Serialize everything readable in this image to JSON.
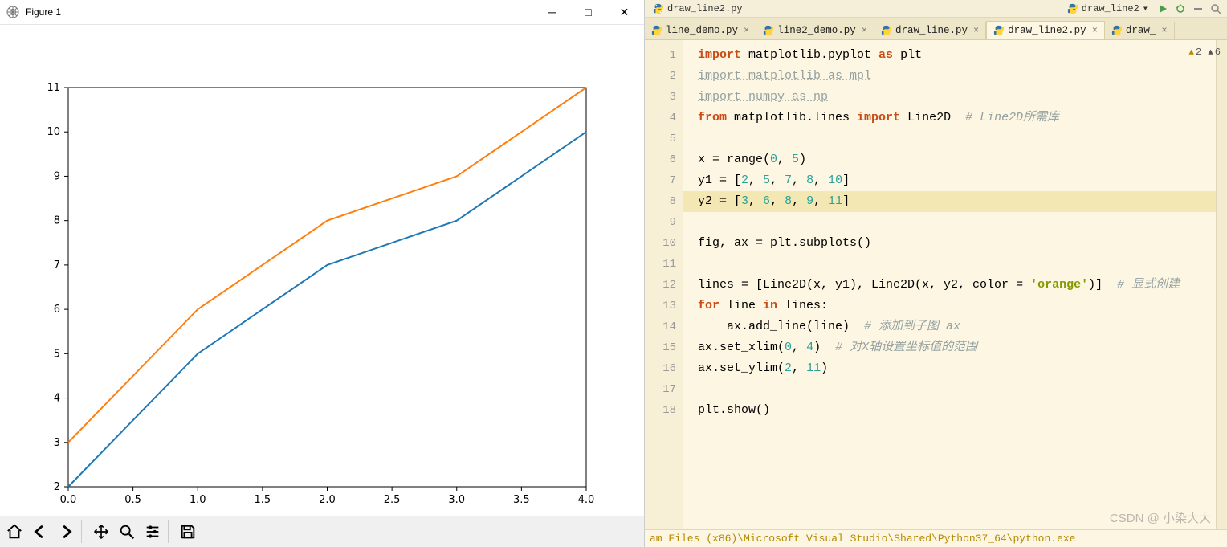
{
  "chart_data": {
    "type": "line",
    "x": [
      0,
      1,
      2,
      3,
      4
    ],
    "series": [
      {
        "name": "y1",
        "values": [
          2,
          5,
          7,
          8,
          10
        ],
        "color": "#1f77b4"
      },
      {
        "name": "y2",
        "values": [
          3,
          6,
          8,
          9,
          11
        ],
        "color": "#ff7f0e"
      }
    ],
    "xlim": [
      0,
      4
    ],
    "ylim": [
      2,
      11
    ],
    "xticks": [
      0.0,
      0.5,
      1.0,
      1.5,
      2.0,
      2.5,
      3.0,
      3.5,
      4.0
    ],
    "yticks": [
      2,
      3,
      4,
      5,
      6,
      7,
      8,
      9,
      10,
      11
    ],
    "xtick_labels": [
      "0.0",
      "0.5",
      "1.0",
      "1.5",
      "2.0",
      "2.5",
      "3.0",
      "3.5",
      "4.0"
    ],
    "ytick_labels": [
      "2",
      "3",
      "4",
      "5",
      "6",
      "7",
      "8",
      "9",
      "10",
      "11"
    ]
  },
  "window": {
    "title": "Figure 1"
  },
  "toolbar": {
    "home": "Home",
    "back": "Back",
    "forward": "Forward",
    "pan": "Pan",
    "zoom": "Zoom",
    "configure": "Configure subplots",
    "save": "Save"
  },
  "ide": {
    "top_tab": "draw_line2.py",
    "combo": "draw_line2",
    "tabs": [
      {
        "label": "line_demo.py",
        "active": false
      },
      {
        "label": "line2_demo.py",
        "active": false
      },
      {
        "label": "draw_line.py",
        "active": false
      },
      {
        "label": "draw_line2.py",
        "active": true
      },
      {
        "label": "draw_",
        "active": false
      }
    ],
    "warnings": "2",
    "criticals": "6",
    "lines": {
      "l1": "import matplotlib.pyplot as plt",
      "l2": "import matplotlib as mpl",
      "l3": "import numpy as np",
      "l4a": "from matplotlib.lines import Line2D ",
      "l4c": "# Line2D所需库",
      "l6": "x = range(0, 5)",
      "l7": "y1 = [2, 5, 7, 8, 10]",
      "l8": "y2 = [3, 6, 8, 9, 11]",
      "l10": "fig, ax = plt.subplots()",
      "l12a": "lines = [Line2D(x, y1), Line2D(x, y2, color = 'orange')] ",
      "l12c": "# 显式创建",
      "l13": "for line in lines:",
      "l14a": "    ax.add_line(line) ",
      "l14c": "# 添加到子图 ax",
      "l15a": "ax.set_xlim(0, 4) ",
      "l15c": "# 对X轴设置坐标值的范围",
      "l16": "ax.set_ylim(2, 11)",
      "l18": "plt.show()"
    },
    "status": "am Files (x86)\\Microsoft Visual Studio\\Shared\\Python37_64\\python.exe",
    "watermark": "CSDN @ 小染大大"
  }
}
